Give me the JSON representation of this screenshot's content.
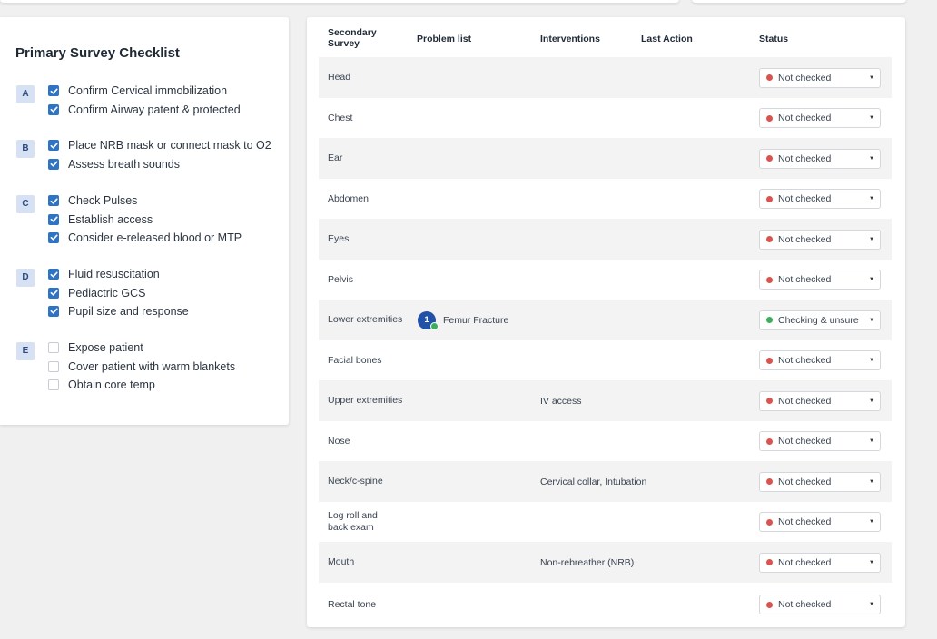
{
  "checklist": {
    "title": "Primary Survey Checklist",
    "groups": [
      {
        "letter": "A",
        "items": [
          {
            "label": "Confirm Cervical immobilization",
            "checked": true
          },
          {
            "label": "Confirm Airway patent & protected",
            "checked": true
          }
        ]
      },
      {
        "letter": "B",
        "items": [
          {
            "label": "Place NRB mask or connect mask to O2",
            "checked": true
          },
          {
            "label": "Assess breath sounds",
            "checked": true
          }
        ]
      },
      {
        "letter": "C",
        "items": [
          {
            "label": "Check Pulses",
            "checked": true
          },
          {
            "label": "Establish access",
            "checked": true
          },
          {
            "label": "Consider e-released blood or MTP",
            "checked": true
          }
        ]
      },
      {
        "letter": "D",
        "items": [
          {
            "label": "Fluid resuscitation",
            "checked": true
          },
          {
            "label": "Pediactric GCS",
            "checked": true
          },
          {
            "label": "Pupil size and response",
            "checked": true
          }
        ]
      },
      {
        "letter": "E",
        "items": [
          {
            "label": "Expose patient",
            "checked": false
          },
          {
            "label": "Cover patient with warm blankets",
            "checked": false
          },
          {
            "label": "Obtain core temp",
            "checked": false
          }
        ]
      }
    ]
  },
  "table": {
    "headers": {
      "secondary": "Secondary Survey",
      "problem": "Problem list",
      "interventions": "Interventions",
      "last_action": "Last Action",
      "status": "Status"
    },
    "rows": [
      {
        "name": "Head",
        "problem": "",
        "interventions": "",
        "status": "Not checked",
        "status_color": "#d9534f",
        "shaded": true
      },
      {
        "name": "Chest",
        "problem": "",
        "interventions": "",
        "status": "Not checked",
        "status_color": "#d9534f",
        "shaded": false
      },
      {
        "name": "Ear",
        "problem": "",
        "interventions": "",
        "status": "Not checked",
        "status_color": "#d9534f",
        "shaded": true
      },
      {
        "name": "Abdomen",
        "problem": "",
        "interventions": "",
        "status": "Not checked",
        "status_color": "#d9534f",
        "shaded": false
      },
      {
        "name": "Eyes",
        "problem": "",
        "interventions": "",
        "status": "Not checked",
        "status_color": "#d9534f",
        "shaded": true
      },
      {
        "name": "Pelvis",
        "problem": "",
        "interventions": "",
        "status": "Not checked",
        "status_color": "#d9534f",
        "shaded": false
      },
      {
        "name": "Lower extremities",
        "problem": "Femur Fracture",
        "problem_count": "1",
        "interventions": "",
        "status": "Checking & unsure",
        "status_color": "#3cae5c",
        "shaded": true
      },
      {
        "name": "Facial bones",
        "problem": "",
        "interventions": "",
        "status": "Not checked",
        "status_color": "#d9534f",
        "shaded": false
      },
      {
        "name": "Upper extremities",
        "problem": "",
        "interventions": "IV access",
        "status": "Not checked",
        "status_color": "#d9534f",
        "shaded": true
      },
      {
        "name": "Nose",
        "problem": "",
        "interventions": "",
        "status": "Not checked",
        "status_color": "#d9534f",
        "shaded": false
      },
      {
        "name": "Neck/c-spine",
        "problem": "",
        "interventions": "Cervical collar, Intubation",
        "status": "Not checked",
        "status_color": "#d9534f",
        "shaded": true
      },
      {
        "name": "Log roll and back exam",
        "problem": "",
        "interventions": "",
        "status": "Not checked",
        "status_color": "#d9534f",
        "shaded": false
      },
      {
        "name": "Mouth",
        "problem": "",
        "interventions": "Non-rebreather (NRB)",
        "status": "Not checked",
        "status_color": "#d9534f",
        "shaded": true
      },
      {
        "name": "Rectal tone",
        "problem": "",
        "interventions": "",
        "status": "Not checked",
        "status_color": "#d9534f",
        "shaded": false
      }
    ]
  },
  "icons": {
    "checkbox_checked": "check-icon",
    "status_dropdown": "caret-down-icon",
    "status_indicator": "status-dot-icon"
  }
}
